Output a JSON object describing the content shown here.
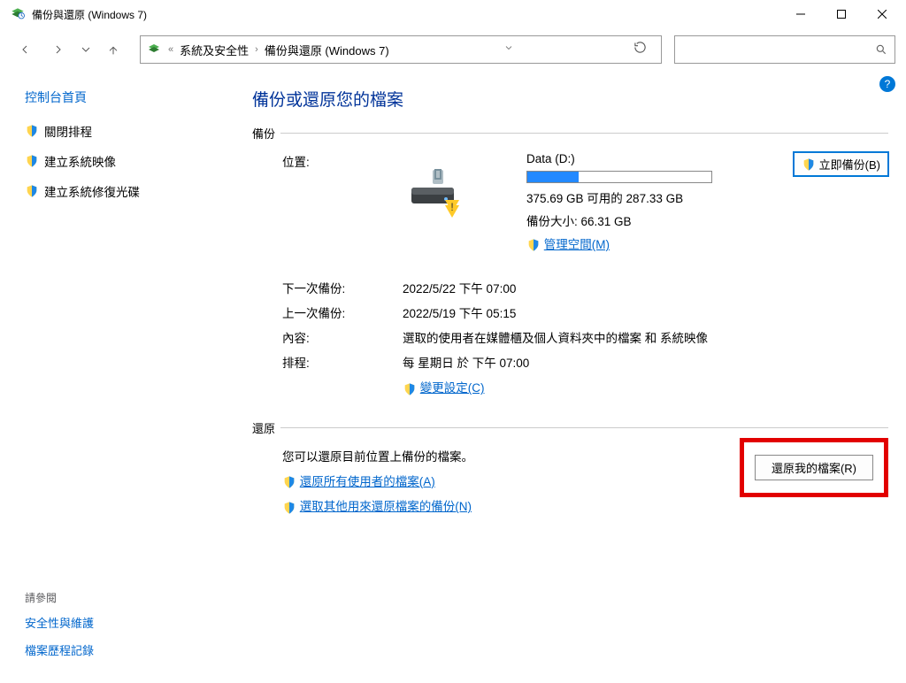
{
  "window": {
    "title": "備份與還原 (Windows 7)"
  },
  "breadcrumb": {
    "seg1": "系統及安全性",
    "seg2": "備份與還原 (Windows 7)"
  },
  "sidebar": {
    "cp_home": "控制台首頁",
    "links": [
      {
        "label": "關閉排程"
      },
      {
        "label": "建立系統映像"
      },
      {
        "label": "建立系統修復光碟"
      }
    ],
    "see_also_heading": "請參閱",
    "see_also": [
      {
        "label": "安全性與維護"
      },
      {
        "label": "檔案歷程記錄"
      }
    ]
  },
  "page": {
    "title": "備份或還原您的檔案"
  },
  "backup": {
    "heading": "備份",
    "location_label": "位置:",
    "location_value": "Data (D:)",
    "free_space": "375.69 GB 可用的 287.33 GB",
    "backup_size": "備份大小: 66.31 GB",
    "manage_space": "管理空間(M)",
    "backup_now_btn": "立即備份(B)",
    "next_label": "下一次備份:",
    "next_value": "2022/5/22 下午 07:00",
    "last_label": "上一次備份:",
    "last_value": "2022/5/19 下午 05:15",
    "content_label": "內容:",
    "content_value": "選取的使用者在媒體櫃及個人資料夾中的檔案 和 系統映像",
    "schedule_label": "排程:",
    "schedule_value": "每 星期日 於 下午 07:00",
    "change_settings": "變更設定(C)"
  },
  "restore": {
    "heading": "還原",
    "desc": "您可以還原目前位置上備份的檔案。",
    "restore_all_users": "還原所有使用者的檔案(A)",
    "select_another": "選取其他用來還原檔案的備份(N)",
    "restore_my_files_btn": "還原我的檔案(R)"
  }
}
